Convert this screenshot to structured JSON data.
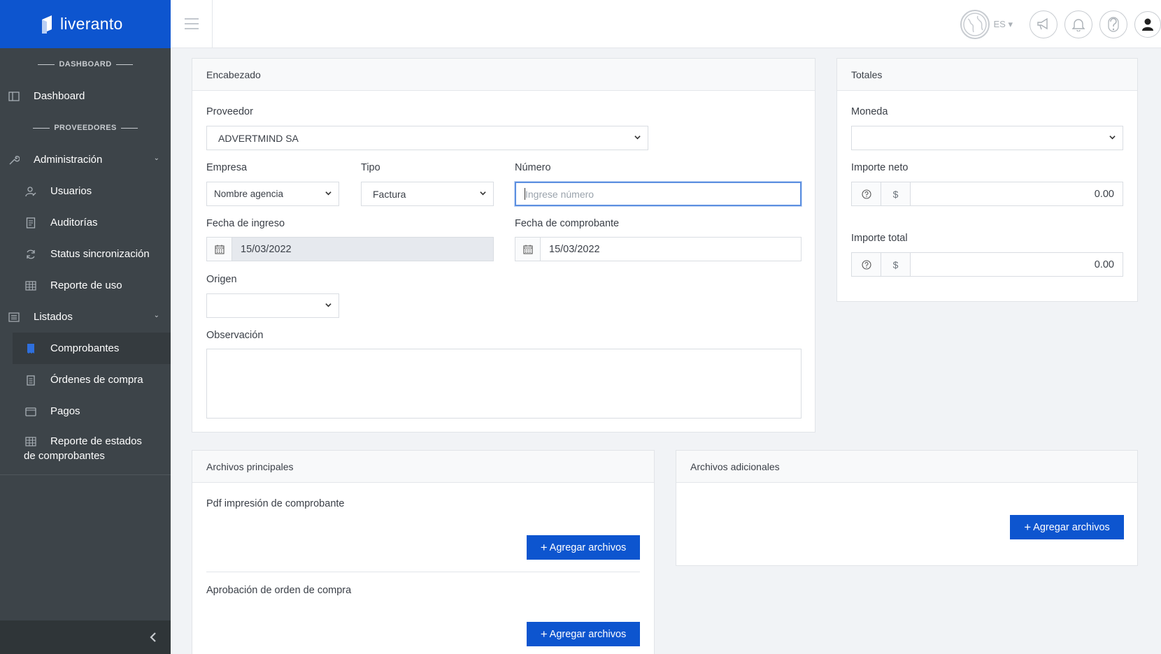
{
  "brand": {
    "name": "liveranto"
  },
  "sidebar": {
    "section_dashboard": "DASHBOARD",
    "dashboard": "Dashboard",
    "section_proveedores": "PROVEEDORES",
    "administracion": "Administración",
    "usuarios": "Usuarios",
    "auditorias": "Auditorías",
    "status": "Status sincronización",
    "reporte_uso": "Reporte de uso",
    "listados": "Listados",
    "comprobantes": "Comprobantes",
    "ordenes": "Órdenes de compra",
    "pagos": "Pagos",
    "reporte_estados_1": "Reporte de estados",
    "reporte_estados_2": "de comprobantes",
    "collapse_icon": "chevron-left-icon"
  },
  "topbar": {
    "lang": "ES"
  },
  "encabezado": {
    "title": "Encabezado",
    "proveedor_label": "Proveedor",
    "proveedor_value": "ADVERTMIND SA",
    "empresa_label": "Empresa",
    "empresa_value": "Nombre agencia",
    "tipo_label": "Tipo",
    "tipo_value": "Factura",
    "numero_label": "Número",
    "numero_placeholder": "Ingrese número",
    "fecha_ingreso_label": "Fecha de ingreso",
    "fecha_ingreso_value": "15/03/2022",
    "fecha_comprobante_label": "Fecha de comprobante",
    "fecha_comprobante_value": "15/03/2022",
    "origen_label": "Origen",
    "origen_value": "",
    "observacion_label": "Observación"
  },
  "totales": {
    "title": "Totales",
    "moneda_label": "Moneda",
    "moneda_value": "",
    "importe_neto_label": "Importe neto",
    "importe_neto_value": "0.00",
    "importe_total_label": "Importe total",
    "importe_total_value": "0.00",
    "currency_symbol": "$"
  },
  "archivos_principales": {
    "title": "Archivos principales",
    "pdf_label": "Pdf impresión de comprobante",
    "aprobacion_label": "Aprobación de orden de compra",
    "add_label": "Agregar archivos"
  },
  "archivos_adicionales": {
    "title": "Archivos adicionales",
    "add_label": "Agregar archivos"
  },
  "colors": {
    "brand": "#0d55cf",
    "sidebar": "#3d4449"
  }
}
